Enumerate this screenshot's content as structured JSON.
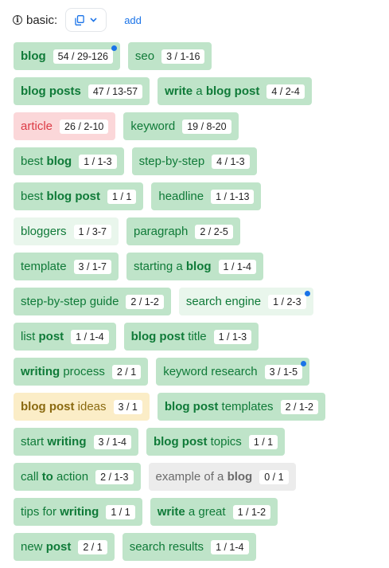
{
  "header": {
    "label": "basic:",
    "add_label": "add",
    "info_icon": "info-circle-icon",
    "copy_icon": "copy-icon",
    "dropdown_icon": "chevron-down-icon"
  },
  "colors": {
    "green_bg": "#bfe4c9",
    "light_green_bg": "#e9f6ec",
    "green_text": "#0f7a38",
    "red_bg": "#fbd7d9",
    "red_text": "#dc3b45",
    "yellow_bg": "#fbedc7",
    "yellow_text": "#8a6a10",
    "gray_bg": "#ececec",
    "gray_text": "#6b6b6b",
    "dot": "#1a73e8",
    "link": "#1a73e8"
  },
  "keywords": [
    [
      {
        "parts": [
          {
            "t": "blog",
            "b": true
          }
        ],
        "count": "54 / 29-126",
        "style": "green",
        "dot": true
      },
      {
        "parts": [
          {
            "t": "seo",
            "b": false
          }
        ],
        "count": "3 / 1-16",
        "style": "green",
        "dot": false
      }
    ],
    [
      {
        "parts": [
          {
            "t": "blog posts",
            "b": true
          }
        ],
        "count": "47 / 13-57",
        "style": "green",
        "dot": false
      },
      {
        "parts": [
          {
            "t": "write",
            "b": true
          },
          {
            "t": " a ",
            "b": false
          },
          {
            "t": "blog post",
            "b": true
          }
        ],
        "count": "4 / 2-4",
        "style": "green",
        "dot": false
      }
    ],
    [
      {
        "parts": [
          {
            "t": "article",
            "b": false
          }
        ],
        "count": "26 / 2-10",
        "style": "red",
        "dot": false
      },
      {
        "parts": [
          {
            "t": "keyword",
            "b": false
          }
        ],
        "count": "19 / 8-20",
        "style": "green",
        "dot": false
      }
    ],
    [
      {
        "parts": [
          {
            "t": "best ",
            "b": false
          },
          {
            "t": "blog",
            "b": true
          }
        ],
        "count": "1 / 1-3",
        "style": "green",
        "dot": false
      },
      {
        "parts": [
          {
            "t": "step-by-step",
            "b": false
          }
        ],
        "count": "4 / 1-3",
        "style": "green",
        "dot": false
      }
    ],
    [
      {
        "parts": [
          {
            "t": "best ",
            "b": false
          },
          {
            "t": "blog post",
            "b": true
          }
        ],
        "count": "1 / 1",
        "style": "green",
        "dot": false
      },
      {
        "parts": [
          {
            "t": "headline",
            "b": false
          }
        ],
        "count": "1 / 1-13",
        "style": "green",
        "dot": false
      }
    ],
    [
      {
        "parts": [
          {
            "t": "bloggers",
            "b": false
          }
        ],
        "count": "1 / 3-7",
        "style": "light",
        "dot": false
      },
      {
        "parts": [
          {
            "t": "paragraph",
            "b": false
          }
        ],
        "count": "2 / 2-5",
        "style": "green",
        "dot": false
      }
    ],
    [
      {
        "parts": [
          {
            "t": "template",
            "b": false
          }
        ],
        "count": "3 / 1-7",
        "style": "green",
        "dot": false
      },
      {
        "parts": [
          {
            "t": "starting a ",
            "b": false
          },
          {
            "t": "blog",
            "b": true
          }
        ],
        "count": "1 / 1-4",
        "style": "green",
        "dot": false
      }
    ],
    [
      {
        "parts": [
          {
            "t": "step-by-step guide",
            "b": false
          }
        ],
        "count": "2 / 1-2",
        "style": "green",
        "dot": false
      },
      {
        "parts": [
          {
            "t": "search engine",
            "b": false
          }
        ],
        "count": "1 / 2-3",
        "style": "light",
        "dot": true
      }
    ],
    [
      {
        "parts": [
          {
            "t": "list ",
            "b": false
          },
          {
            "t": "post",
            "b": true
          }
        ],
        "count": "1 / 1-4",
        "style": "green",
        "dot": false
      },
      {
        "parts": [
          {
            "t": "blog post",
            "b": true
          },
          {
            "t": " title",
            "b": false
          }
        ],
        "count": "1 / 1-3",
        "style": "green",
        "dot": false
      }
    ],
    [
      {
        "parts": [
          {
            "t": "writing",
            "b": true
          },
          {
            "t": " process",
            "b": false
          }
        ],
        "count": "2 / 1",
        "style": "green",
        "dot": false
      },
      {
        "parts": [
          {
            "t": "keyword research",
            "b": false
          }
        ],
        "count": "3 / 1-5",
        "style": "green",
        "dot": true
      }
    ],
    [
      {
        "parts": [
          {
            "t": "blog post",
            "b": true
          },
          {
            "t": " ideas",
            "b": false
          }
        ],
        "count": "3 / 1",
        "style": "yellow",
        "dot": false
      },
      {
        "parts": [
          {
            "t": "blog post",
            "b": true
          },
          {
            "t": " templates",
            "b": false
          }
        ],
        "count": "2 / 1-2",
        "style": "green",
        "dot": false
      }
    ],
    [
      {
        "parts": [
          {
            "t": "start ",
            "b": false
          },
          {
            "t": "writing",
            "b": true
          }
        ],
        "count": "3 / 1-4",
        "style": "green",
        "dot": false
      },
      {
        "parts": [
          {
            "t": "blog post",
            "b": true
          },
          {
            "t": " topics",
            "b": false
          }
        ],
        "count": "1 / 1",
        "style": "green",
        "dot": false
      }
    ],
    [
      {
        "parts": [
          {
            "t": "call ",
            "b": false
          },
          {
            "t": "to",
            "b": true
          },
          {
            "t": " action",
            "b": false
          }
        ],
        "count": "2 / 1-3",
        "style": "green",
        "dot": false
      },
      {
        "parts": [
          {
            "t": "example of a ",
            "b": false
          },
          {
            "t": "blog",
            "b": true
          }
        ],
        "count": "0 / 1",
        "style": "gray",
        "dot": false
      }
    ],
    [
      {
        "parts": [
          {
            "t": "tips for ",
            "b": false
          },
          {
            "t": "writing",
            "b": true
          }
        ],
        "count": "1 / 1",
        "style": "green",
        "dot": false
      },
      {
        "parts": [
          {
            "t": "write",
            "b": true
          },
          {
            "t": " a great",
            "b": false
          }
        ],
        "count": "1 / 1-2",
        "style": "green",
        "dot": false
      }
    ],
    [
      {
        "parts": [
          {
            "t": "new ",
            "b": false
          },
          {
            "t": "post",
            "b": true
          }
        ],
        "count": "2 / 1",
        "style": "green",
        "dot": false
      },
      {
        "parts": [
          {
            "t": "search results",
            "b": false
          }
        ],
        "count": "1 / 1-4",
        "style": "green",
        "dot": false
      }
    ]
  ]
}
